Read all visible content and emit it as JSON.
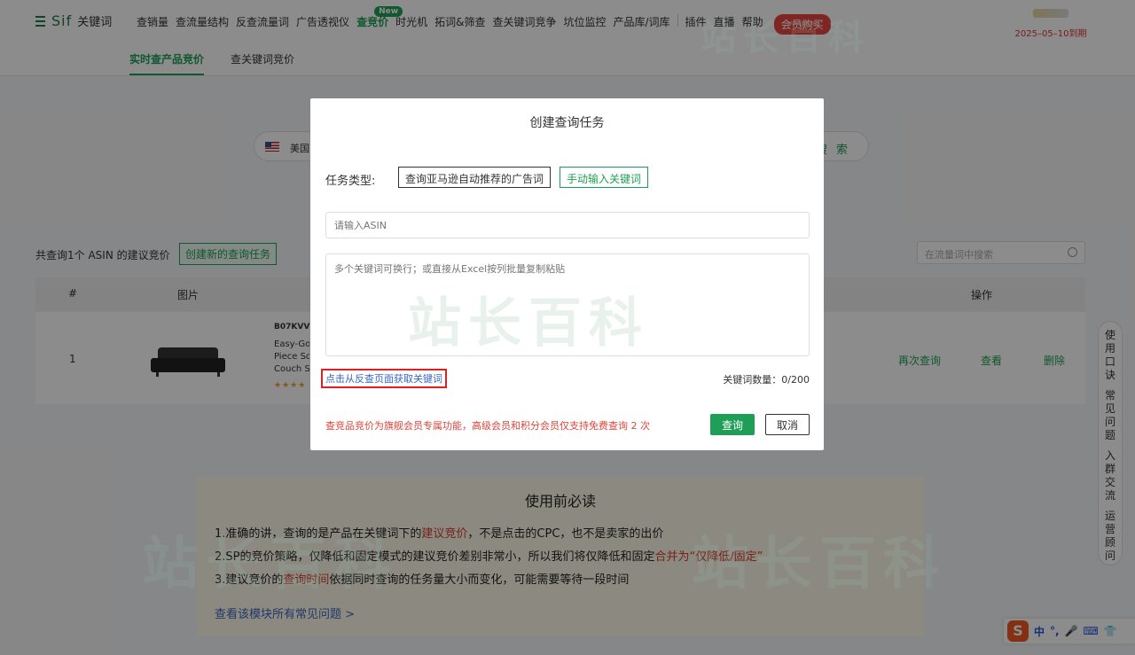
{
  "header": {
    "brand": "Sif",
    "brand_suffix": "关键词",
    "nav": [
      "查销量",
      "查流量结构",
      "反查流量词",
      "广告透视仪",
      "查竞价",
      "时光机",
      "拓词&筛查",
      "查关键词竞争",
      "坑位监控",
      "产品库/词库"
    ],
    "nav_active_index": 4,
    "nav_new_badge": "New",
    "nav_right": [
      "插件",
      "直播",
      "帮助"
    ],
    "member_button": "会员购买",
    "expiry": "2025–05–10到期"
  },
  "subnav": {
    "tabs": [
      "实时查产品竞价",
      "查关键词竞价"
    ],
    "active_index": 0
  },
  "search": {
    "country": "美国",
    "button": "搜 索"
  },
  "results": {
    "summary": "共查询1个 ASIN 的建议竞价",
    "new_task_button": "创建新的查询任务",
    "table_search_placeholder": "在流量词中搜索",
    "columns": {
      "index": "#",
      "image": "图片",
      "actions": "操作"
    },
    "rows": [
      {
        "index": "1",
        "asin": "B07KVVI",
        "title_lines": [
          "Easy-Go",
          "Piece So",
          "Couch S"
        ],
        "stars": "★★★★",
        "actions": [
          "再次查询",
          "查看",
          "删除"
        ]
      }
    ]
  },
  "notice": {
    "title": "使用前必读",
    "line1_pre": "1.准确的讲，查询的是产品在关键词下的",
    "line1_hl": "建议竞价",
    "line1_post": "，不是点击的CPC，也不是卖家的出价",
    "line2_pre": "2.SP的竞价策略，仅降低和固定模式的建议竞价差别非常小，所以我们将仅降低和固定",
    "line2_hl": "合并为“仅降低/固定”",
    "line3_pre": "3.建议竞价的",
    "line3_hl": "查询时间",
    "line3_post": "依据同时查询的任务量大小而变化，可能需要等待一段时间",
    "faq_link": "查看该模块所有常见问题 >"
  },
  "side_help": [
    "使用口诀",
    "常见问题",
    "入群交流",
    "运营顾问"
  ],
  "ime": {
    "logo": "S",
    "lang": "中",
    "punct": "°,"
  },
  "watermark": "站长百科",
  "modal": {
    "title": "创建查询任务",
    "type_label": "任务类型:",
    "type_option_amazon": "查询亚马逊自动推荐的广告词",
    "type_option_manual": "手动输入关键词",
    "asin_placeholder": "请输入ASIN",
    "keywords_placeholder": "多个关键词可换行；或直接从Excel按列批量复制粘贴",
    "fetch_link": "点击从反查页面获取关键词",
    "keyword_count_label": "关键词数量：",
    "keyword_count_value": "0/200",
    "vip_notice": "查竞品竞价为旗舰会员专属功能，高级会员和积分会员仅支持免费查询 2 次",
    "query_button": "查询",
    "cancel_button": "取消"
  },
  "colors": {
    "accent": "#1f9e57",
    "danger": "#e0443a",
    "link": "#3a66c2"
  }
}
